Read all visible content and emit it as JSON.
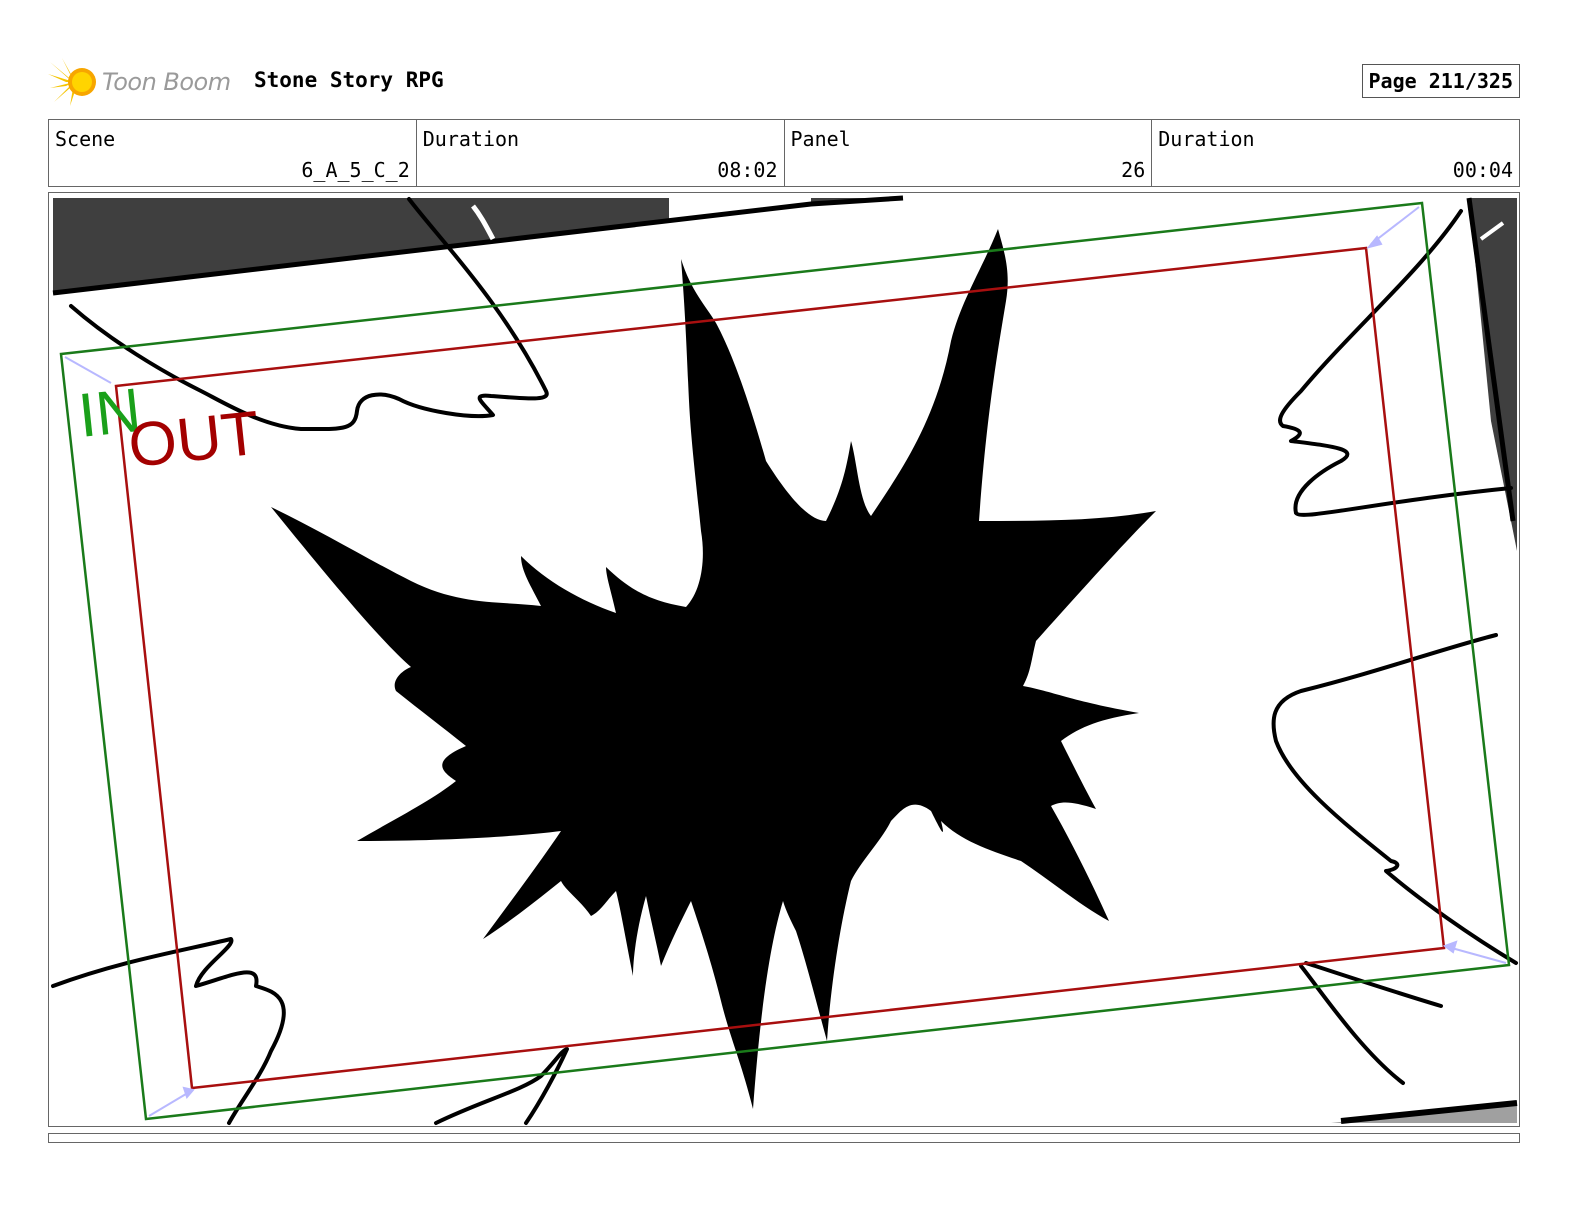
{
  "logo": {
    "text": "Toon Boom",
    "icon": "toon-boom-sun-icon"
  },
  "project": {
    "title": "Stone Story RPG"
  },
  "page": {
    "label": "Page 211/325"
  },
  "info": {
    "scene_label": "Scene",
    "scene_value": "6_A_5_C_2",
    "scene_duration_label": "Duration",
    "scene_duration_value": "08:02",
    "panel_label": "Panel",
    "panel_value": "26",
    "panel_duration_label": "Duration",
    "panel_duration_value": "00:04"
  },
  "camera": {
    "in_label": "IN",
    "out_label": "OUT",
    "in_color": "#1aa01a",
    "out_color": "#a30000"
  }
}
